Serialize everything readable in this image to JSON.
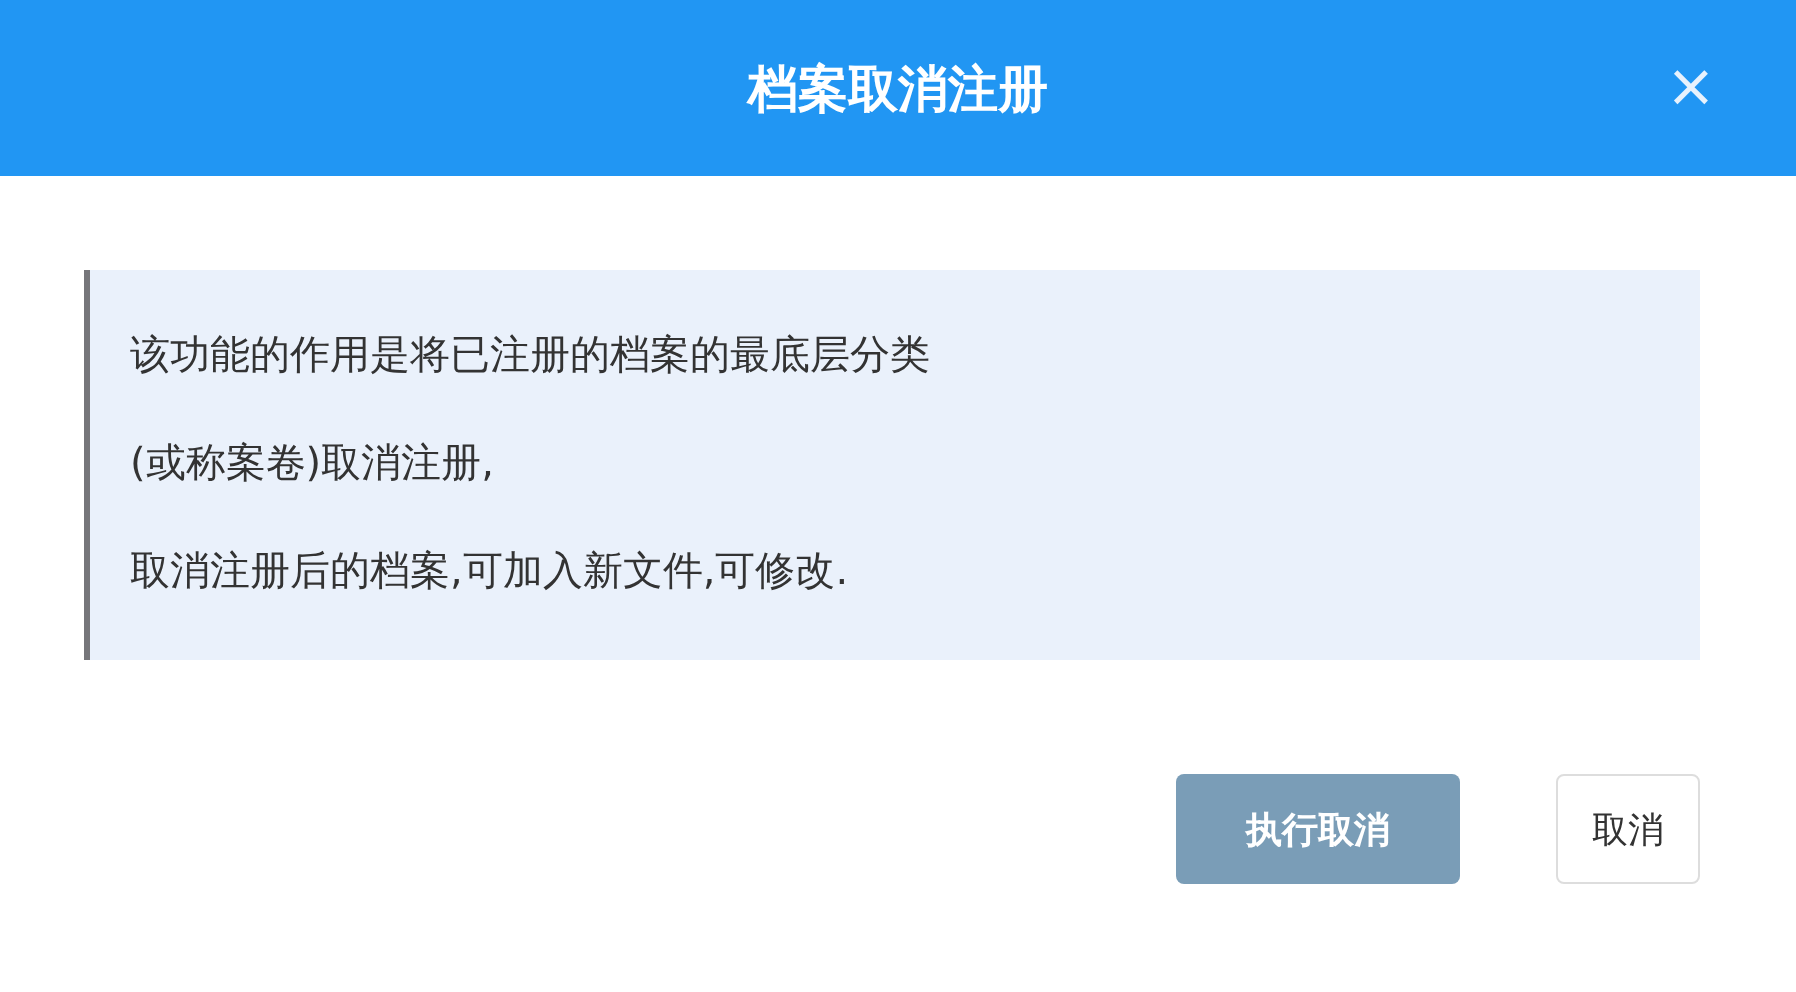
{
  "dialog": {
    "title": "档案取消注册",
    "close": "×"
  },
  "notice": {
    "lines": [
      "该功能的作用是将已注册的档案的最底层分类",
      "(或称案卷)取消注册,",
      "取消注册后的档案,可加入新文件,可修改."
    ]
  },
  "buttons": [
    {
      "label": "执行取消",
      "kind": "primary"
    },
    {
      "label": "取消",
      "kind": "default"
    }
  ]
}
